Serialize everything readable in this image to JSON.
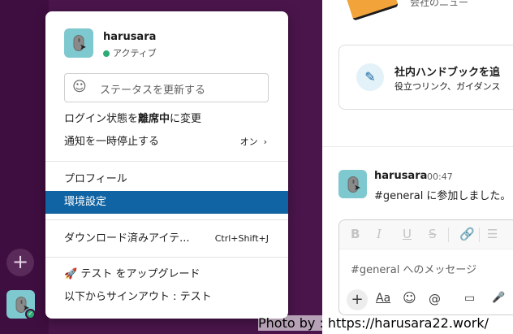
{
  "colors": {
    "sidebar": "#3f0e40",
    "sidebar_ext": "#4a154b",
    "menu_selected": "#1164a3",
    "presence": "#2bac76"
  },
  "sidebar": {
    "add_icon": "+",
    "avatar_icon": "mouse-icon"
  },
  "main": {
    "top_text": "会社のニュー",
    "card": {
      "icon": "note-icon",
      "title": "社内ハンドブックを追",
      "subtitle": "役立つリンク、ガイダンス"
    },
    "message": {
      "author": "harusara",
      "time": "00:47",
      "text": "#general に参加しました。"
    },
    "composer": {
      "placeholder": "#general へのメッセージ",
      "format_buttons": [
        "B",
        "I",
        "U",
        "S",
        "🔗",
        "☰"
      ],
      "tools": [
        "+",
        "Aa",
        "☺",
        "@",
        "▭",
        "🎤"
      ]
    }
  },
  "menu": {
    "user_name": "harusara",
    "presence": "アクティブ",
    "status_placeholder": "ステータスを更新する",
    "away_prefix": "ログイン状態を",
    "away_bold": "離席中",
    "away_suffix": "に変更",
    "pause_notifications": "通知を一時停止する",
    "pause_value": "オン",
    "profile": "プロフィール",
    "preferences": "環境設定",
    "downloads": "ダウンロード済みアイテ...",
    "downloads_shortcut": "Ctrl+Shift+J",
    "upgrade": "テスト をアップグレード",
    "sign_out": "以下からサインアウト : テスト"
  },
  "watermark": "Photo by : https://harusara22.work/"
}
